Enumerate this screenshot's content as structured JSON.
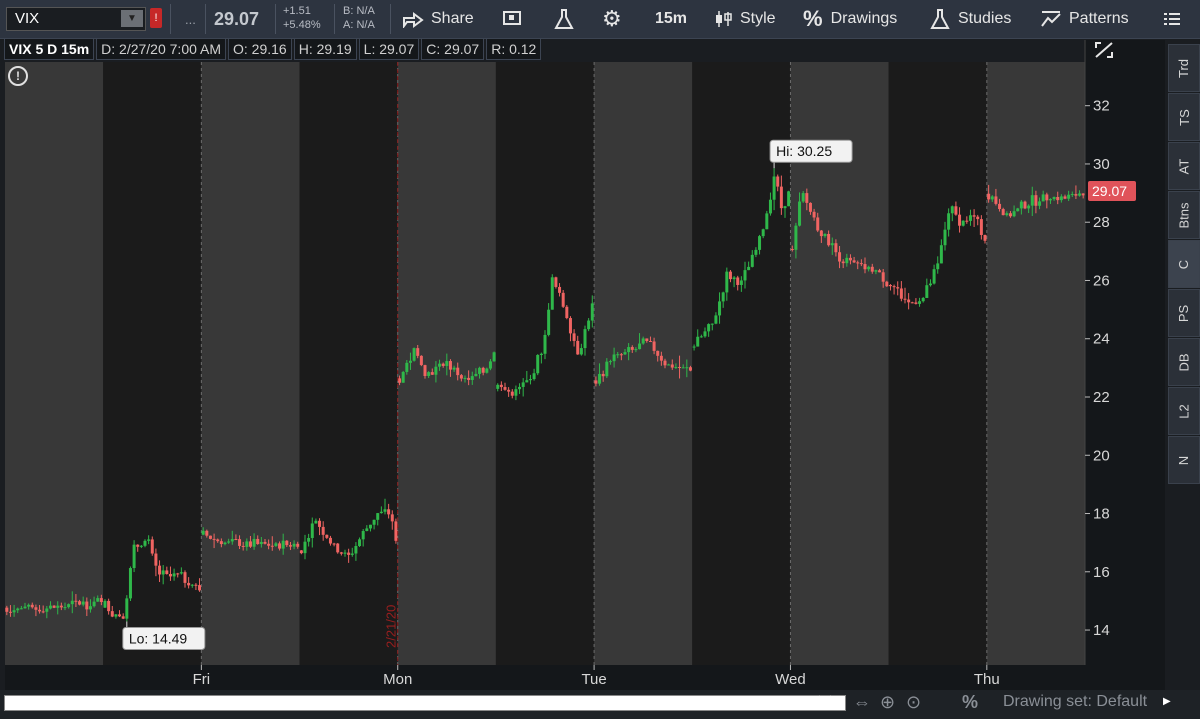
{
  "toolbar": {
    "symbol": "VIX",
    "flag": "!",
    "ellipsis": "...",
    "last": "29.07",
    "change_abs": "+1.51",
    "change_pct": "+5.48%",
    "bid": "B: N/A",
    "ask": "A: N/A",
    "share": "Share",
    "interval": "15m",
    "style": "Style",
    "drawings": "Drawings",
    "studies": "Studies",
    "patterns": "Patterns"
  },
  "infobar": {
    "symbol": "VIX 5 D 15m",
    "date": "D: 2/27/20 7:00 AM",
    "open": "O: 29.16",
    "high": "H: 29.19",
    "low": "L: 29.07",
    "close": "C: 29.07",
    "range": "R: 0.12"
  },
  "sidebar": [
    "Trd",
    "TS",
    "AT",
    "Btns",
    "C",
    "PS",
    "DB",
    "L2",
    "N"
  ],
  "bottom": {
    "drawing_set": "Drawing set: Default"
  },
  "colors": {
    "up": "#2fb84a",
    "down": "#f06462",
    "bg_dark": "#1b1b1b",
    "bg_light": "#383838",
    "last_tag": "#e0535a"
  },
  "chart_data": {
    "type": "candlestick",
    "symbol": "VIX",
    "ylim": [
      12.8,
      33.5
    ],
    "y_ticks": [
      14,
      16,
      18,
      20,
      22,
      24,
      26,
      28,
      30,
      32
    ],
    "day_labels": [
      {
        "label": "Fri",
        "session": 2
      },
      {
        "label": "Mon",
        "session": 4
      },
      {
        "label": "Tue",
        "session": 6
      },
      {
        "label": "Wed",
        "session": 8
      },
      {
        "label": "Thu",
        "session": 10
      }
    ],
    "date_marker": "2/21/20",
    "annotations": {
      "high": "Hi: 30.25",
      "low": "Lo: 14.49"
    },
    "last_price": "29.07",
    "sessions": [
      {
        "type": "ext",
        "path": [
          [
            0,
            14.75
          ],
          [
            0.3,
            14.72
          ],
          [
            0.6,
            14.8
          ],
          [
            0.85,
            14.95
          ],
          [
            1,
            14.92
          ]
        ]
      },
      {
        "type": "reg",
        "path": [
          [
            0,
            14.85
          ],
          [
            0.1,
            14.55
          ],
          [
            0.2,
            14.49
          ],
          [
            0.3,
            16.8
          ],
          [
            0.45,
            17.1
          ],
          [
            0.55,
            16.0
          ],
          [
            0.65,
            15.8
          ],
          [
            0.8,
            15.85
          ],
          [
            1,
            15.4
          ]
        ]
      },
      {
        "type": "ext",
        "path": [
          [
            0,
            17.3
          ],
          [
            0.2,
            17.0
          ],
          [
            0.5,
            16.95
          ],
          [
            0.8,
            16.9
          ],
          [
            1,
            16.95
          ]
        ]
      },
      {
        "type": "reg",
        "path": [
          [
            0,
            16.7
          ],
          [
            0.15,
            17.8
          ],
          [
            0.35,
            16.8
          ],
          [
            0.5,
            16.5
          ],
          [
            0.65,
            17.3
          ],
          [
            0.8,
            18.0
          ],
          [
            0.95,
            18.0
          ],
          [
            1,
            17.0
          ]
        ]
      },
      {
        "type": "ext",
        "path": [
          [
            0,
            22.6
          ],
          [
            0.15,
            23.6
          ],
          [
            0.3,
            22.8
          ],
          [
            0.5,
            23.2
          ],
          [
            0.7,
            22.5
          ],
          [
            0.9,
            22.9
          ],
          [
            1,
            23.5
          ]
        ]
      },
      {
        "type": "reg",
        "path": [
          [
            0,
            22.4
          ],
          [
            0.15,
            22.1
          ],
          [
            0.35,
            22.6
          ],
          [
            0.5,
            24.0
          ],
          [
            0.57,
            26.1
          ],
          [
            0.7,
            25.1
          ],
          [
            0.85,
            23.5
          ],
          [
            1,
            25.1
          ]
        ]
      },
      {
        "type": "ext",
        "path": [
          [
            0,
            22.5
          ],
          [
            0.15,
            23.3
          ],
          [
            0.4,
            23.6
          ],
          [
            0.55,
            23.9
          ],
          [
            0.75,
            23.1
          ],
          [
            0.9,
            23.0
          ],
          [
            1,
            22.9
          ]
        ]
      },
      {
        "type": "reg",
        "path": [
          [
            0,
            23.8
          ],
          [
            0.2,
            24.5
          ],
          [
            0.35,
            26.2
          ],
          [
            0.5,
            25.9
          ],
          [
            0.65,
            27.0
          ],
          [
            0.75,
            28.0
          ],
          [
            0.85,
            29.7
          ],
          [
            0.92,
            28.5
          ],
          [
            1,
            29.0
          ]
        ]
      },
      {
        "type": "ext",
        "path": [
          [
            0,
            27.0
          ],
          [
            0.1,
            29.0
          ],
          [
            0.3,
            27.7
          ],
          [
            0.5,
            26.8
          ],
          [
            0.7,
            26.5
          ],
          [
            0.9,
            26.3
          ],
          [
            1,
            25.9
          ]
        ]
      },
      {
        "type": "reg",
        "path": [
          [
            0,
            25.9
          ],
          [
            0.2,
            25.2
          ],
          [
            0.35,
            25.4
          ],
          [
            0.5,
            26.5
          ],
          [
            0.62,
            28.5
          ],
          [
            0.75,
            28.0
          ],
          [
            0.88,
            28.2
          ],
          [
            1,
            27.4
          ]
        ]
      },
      {
        "type": "ext",
        "path": [
          [
            0,
            29.0
          ],
          [
            0.2,
            28.2
          ],
          [
            0.4,
            28.6
          ],
          [
            0.6,
            28.9
          ],
          [
            0.8,
            28.8
          ],
          [
            1,
            29.07
          ]
        ]
      }
    ]
  }
}
